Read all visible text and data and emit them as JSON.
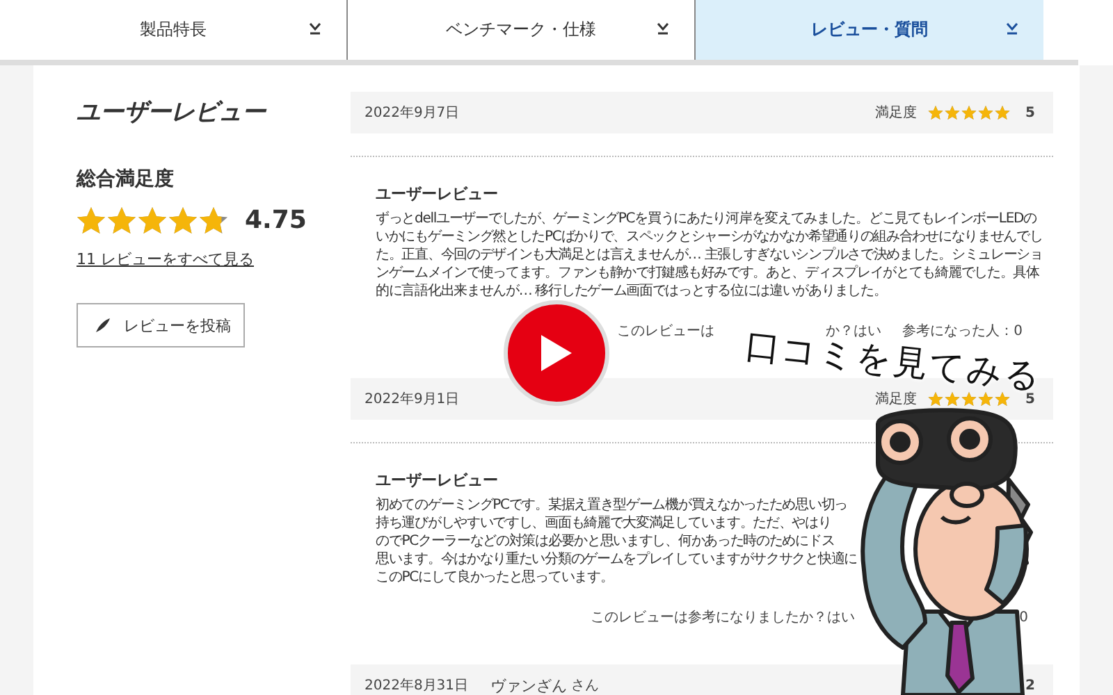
{
  "tabs": [
    {
      "label": "製品特長",
      "selected": false
    },
    {
      "label": "ベンチマーク・仕様",
      "selected": false
    },
    {
      "label": "レビュー・質問",
      "selected": true
    }
  ],
  "summary": {
    "title": "ユーザーレビュー",
    "rating_label": "総合満足度",
    "stars": 4.75,
    "score": "4.75",
    "all_reviews_link": "11 レビューをすべて見る",
    "post_button": "レビューを投稿"
  },
  "reviews": [
    {
      "date": "2022年9月7日",
      "rating_label": "満足度",
      "stars": 5,
      "score": "5",
      "title": "ユーザーレビュー",
      "body_lines": [
        "ずっとdellユーザーでしたが、ゲーミングPCを買うにあたり河岸を変えてみました。どこ見てもレインボーLEDの",
        "いかにもゲーミング然としたPCばかりで、スペックとシャーシがなかなか希望通りの組み合わせになりませんでし",
        "た。正直、今回のデザインも大満足とは言えませんが… 主張しすぎないシンプルさで決めました。シミュレーショ",
        "ンゲームメインで使ってます。ファンも静かで打鍵感も好みです。あと、ディスプレイがとても綺麗でした。具体",
        "的に言語化出来ませんが… 移行したゲーム画面ではっとする位には違いがありました。"
      ],
      "helpful": [
        "このレビューは",
        "か？はい",
        "参考になった人：0"
      ]
    },
    {
      "date": "2022年9月1日",
      "rating_label": "満足度",
      "stars": 5,
      "score": "5",
      "title": "ユーザーレビュー",
      "body_lines": [
        "初めてのゲーミングPCです。某据え置き型ゲーム機が買えなかったため思い切っ",
        "持ち運びがしやすいですし、画面も綺麗で大変満足しています。ただ、やはり",
        "のでPCクーラーなどの対策は必要かと思いますし、何かあった時のためにドス",
        "思います。今はかなり重たい分類のゲームをプレイしていますがサクサクと快適に",
        "このPCにして良かったと思っています。"
      ],
      "helpful": [
        "このレビューは参考になりましたか？はい",
        "0"
      ]
    },
    {
      "date": "2022年8月31日",
      "reviewer": "ヴァンざん",
      "reviewer_suffix": "さん",
      "score": "2"
    }
  ],
  "overlay": {
    "caption": "口コミを見てみる"
  }
}
